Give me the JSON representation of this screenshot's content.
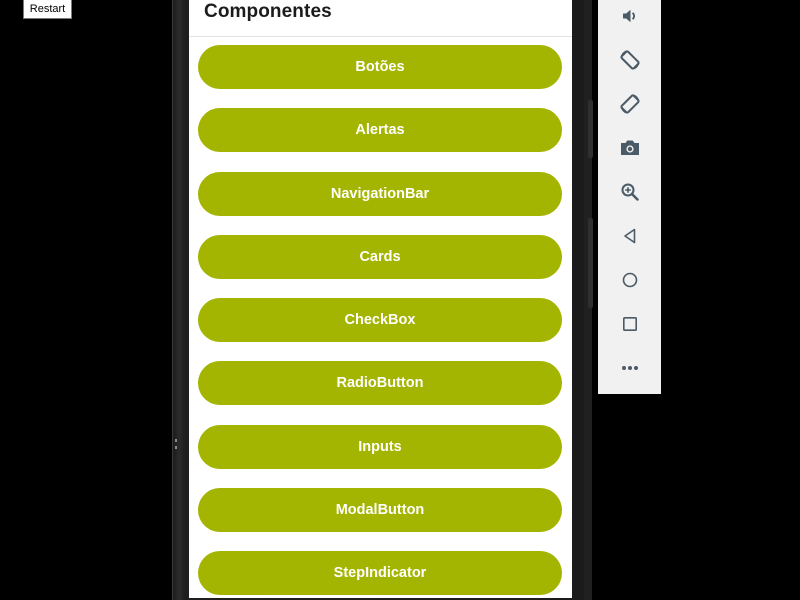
{
  "restart": {
    "label": "Restart"
  },
  "app": {
    "title": "Componentes",
    "buttons": [
      {
        "label": "Botões"
      },
      {
        "label": "Alertas"
      },
      {
        "label": "NavigationBar"
      },
      {
        "label": "Cards"
      },
      {
        "label": "CheckBox"
      },
      {
        "label": "RadioButton"
      },
      {
        "label": "Inputs"
      },
      {
        "label": "ModalButton"
      },
      {
        "label": "StepIndicator"
      }
    ]
  },
  "emulator_toolbar": {
    "items": [
      {
        "icon": "volume-icon"
      },
      {
        "icon": "rotate-left-icon"
      },
      {
        "icon": "rotate-right-icon"
      },
      {
        "icon": "camera-icon"
      },
      {
        "icon": "zoom-icon"
      },
      {
        "icon": "back-icon"
      },
      {
        "icon": "home-icon"
      },
      {
        "icon": "overview-icon"
      },
      {
        "icon": "more-icon"
      }
    ]
  },
  "colors": {
    "button_bg": "#a3b500",
    "button_text": "#ffffff",
    "title_text": "#1c1c1c",
    "toolbar_bg": "#f1f1f1",
    "toolbar_icon": "#4a5a66"
  }
}
